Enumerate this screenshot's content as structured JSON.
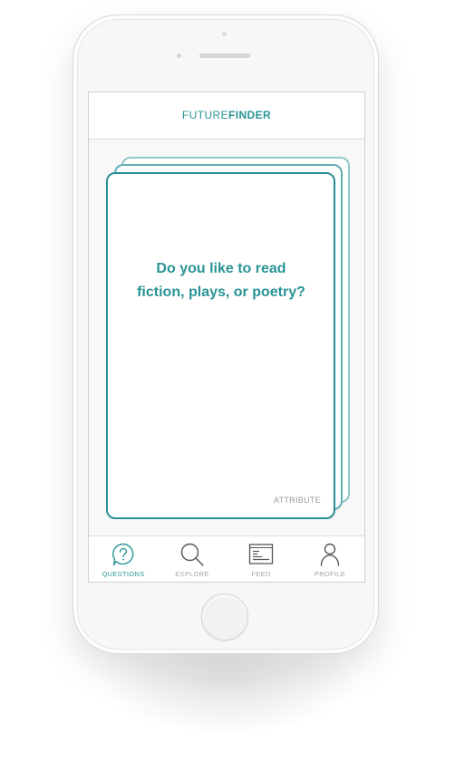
{
  "header": {
    "logo_light": "FUTURE",
    "logo_bold": "FINDER"
  },
  "card": {
    "question": "Do you like to read fiction, plays, or poetry?",
    "attribute_label": "ATTRIBUTE"
  },
  "tabs": [
    {
      "label": "QUESTIONS",
      "icon": "question-bubble-icon",
      "active": true
    },
    {
      "label": "EXPLORE",
      "icon": "search-icon",
      "active": false
    },
    {
      "label": "FEED",
      "icon": "feed-icon",
      "active": false
    },
    {
      "label": "PROFILE",
      "icon": "profile-icon",
      "active": false
    }
  ],
  "colors": {
    "accent": "#2a9496",
    "card_border": "#2a8f92",
    "card_back_1": "#5eaeb1",
    "card_back_2": "#8fc8ca",
    "inactive": "#a6a6a6"
  }
}
